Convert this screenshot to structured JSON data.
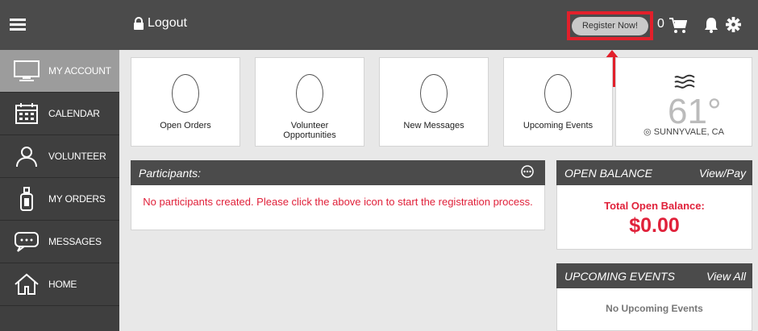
{
  "header": {
    "logout_label": "Logout",
    "register_label": "Register Now!",
    "cart_count": "0"
  },
  "sidebar": {
    "items": [
      {
        "label": "MY ACCOUNT",
        "icon": "monitor-icon",
        "active": true
      },
      {
        "label": "CALENDAR",
        "icon": "calendar-icon"
      },
      {
        "label": "VOLUNTEER",
        "icon": "person-icon"
      },
      {
        "label": "MY ORDERS",
        "icon": "bottle-icon"
      },
      {
        "label": "MESSAGES",
        "icon": "chat-icon"
      },
      {
        "label": "HOME",
        "icon": "home-icon"
      }
    ]
  },
  "stats": [
    {
      "value": "0",
      "label": "Open Orders"
    },
    {
      "value": "0",
      "label": "Volunteer Opportunities"
    },
    {
      "value": "0",
      "label": "New Messages"
    },
    {
      "value": "0",
      "label": "Upcoming Events"
    }
  ],
  "weather": {
    "temperature": "61°",
    "location": "SUNNYVALE, CA"
  },
  "participants": {
    "title": "Participants:",
    "message": "No participants created. Please click the above icon to start the registration process."
  },
  "open_balance": {
    "title": "OPEN BALANCE",
    "action": "View/Pay",
    "label": "Total Open Balance:",
    "value": "$0.00"
  },
  "upcoming_events": {
    "title": "UPCOMING EVENTS",
    "action": "View All",
    "empty": "No Upcoming Events"
  },
  "colors": {
    "topbar": "#4b4b4b",
    "sidebar": "#3f3f3f",
    "active_item": "#9c9c9c",
    "accent_red": "#e0213a",
    "highlight_red": "#e2202b"
  }
}
